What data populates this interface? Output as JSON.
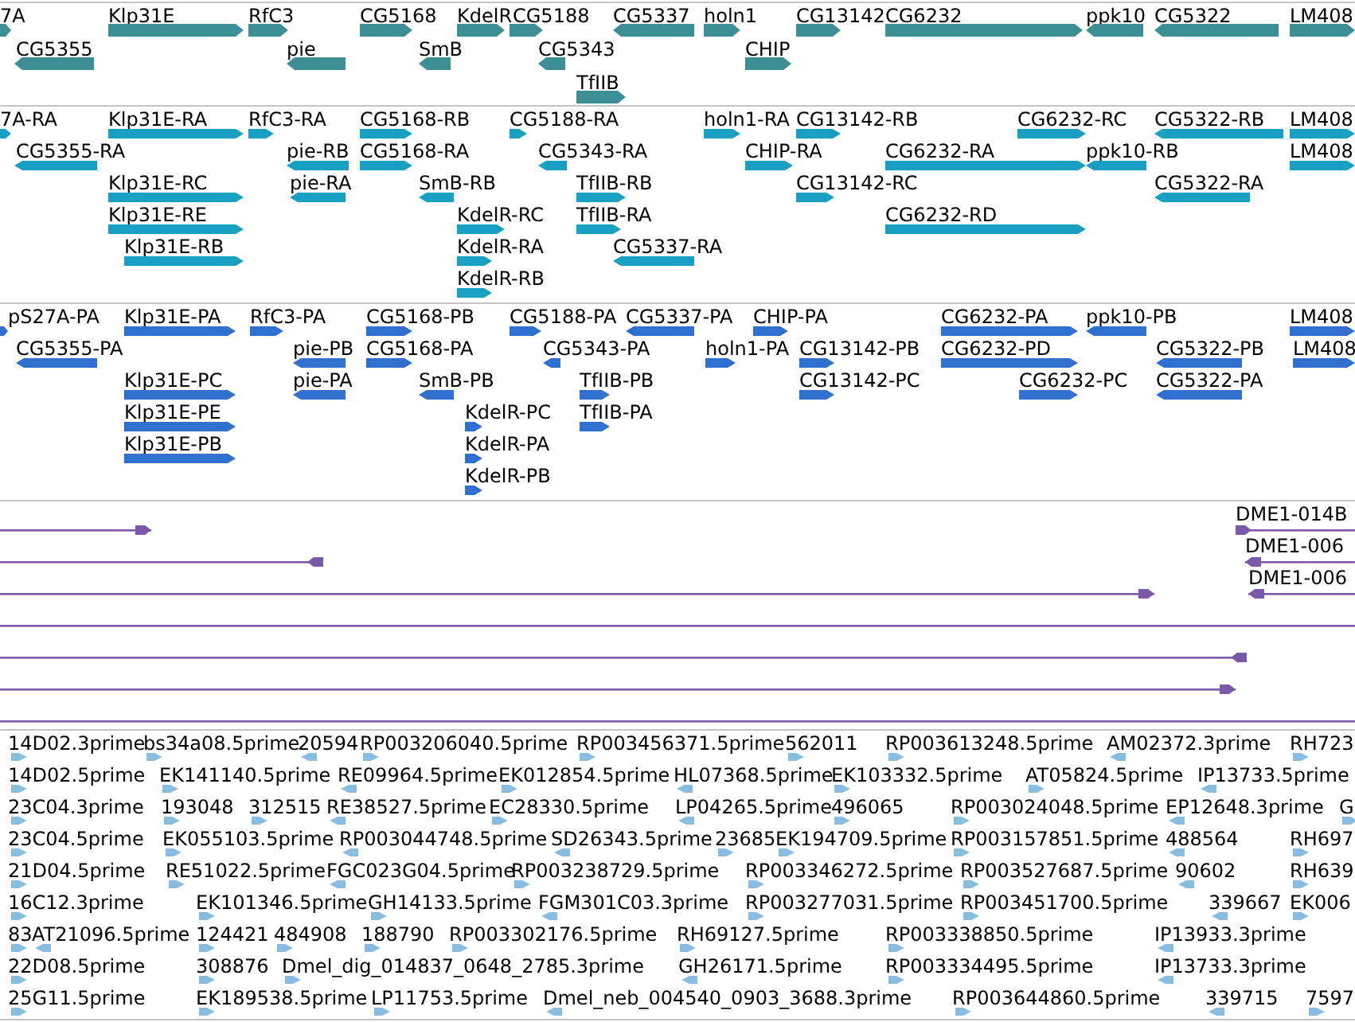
{
  "tracks": [
    {
      "kind": "gene",
      "features": [
        {
          "label": "7A",
          "reverse": false
        },
        {
          "label": "Klp31E",
          "reverse": false
        },
        {
          "label": "RfC3",
          "reverse": false
        },
        {
          "label": "CG5168",
          "reverse": false
        },
        {
          "label": "KdelR",
          "reverse": false
        },
        {
          "label": "CG5188",
          "reverse": false
        },
        {
          "label": "CG5337",
          "reverse": true
        },
        {
          "label": "holn1",
          "reverse": false
        },
        {
          "label": "CG13142",
          "reverse": false
        },
        {
          "label": "CG6232",
          "reverse": false
        },
        {
          "label": "ppk10",
          "reverse": true
        },
        {
          "label": "CG5322",
          "reverse": true
        },
        {
          "label": "LM408",
          "reverse": false
        },
        {
          "label": "CG5355",
          "reverse": true
        },
        {
          "label": "pie",
          "reverse": true
        },
        {
          "label": "SmB",
          "reverse": true
        },
        {
          "label": "CG5343",
          "reverse": true
        },
        {
          "label": "CHIP",
          "reverse": false
        },
        {
          "label": "TfIIB",
          "reverse": false
        }
      ]
    },
    {
      "kind": "transcript",
      "features": [
        {
          "label": "7A-RA",
          "reverse": false
        },
        {
          "label": "Klp31E-RA",
          "reverse": false
        },
        {
          "label": "RfC3-RA",
          "reverse": false
        },
        {
          "label": "CG5168-RB",
          "reverse": false
        },
        {
          "label": "CG5188-RA",
          "reverse": false
        },
        {
          "label": "holn1-RA",
          "reverse": false
        },
        {
          "label": "CG13142-RB",
          "reverse": false
        },
        {
          "label": "CG6232-RC",
          "reverse": false
        },
        {
          "label": "CG5322-RB",
          "reverse": true
        },
        {
          "label": "LM408",
          "reverse": false
        },
        {
          "label": "CG5355-RA",
          "reverse": true
        },
        {
          "label": "pie-RB",
          "reverse": true
        },
        {
          "label": "CG5168-RA",
          "reverse": false
        },
        {
          "label": "CG5343-RA",
          "reverse": true
        },
        {
          "label": "CHIP-RA",
          "reverse": false
        },
        {
          "label": "CG6232-RA",
          "reverse": false
        },
        {
          "label": "ppk10-RB",
          "reverse": true
        },
        {
          "label": "LM408",
          "reverse": false
        },
        {
          "label": "Klp31E-RC",
          "reverse": false
        },
        {
          "label": "pie-RA",
          "reverse": true
        },
        {
          "label": "SmB-RB",
          "reverse": true
        },
        {
          "label": "TfIIB-RB",
          "reverse": false
        },
        {
          "label": "CG13142-RC",
          "reverse": false
        },
        {
          "label": "CG5322-RA",
          "reverse": true
        },
        {
          "label": "Klp31E-RE",
          "reverse": false
        },
        {
          "label": "KdelR-RC",
          "reverse": false
        },
        {
          "label": "TfIIB-RA",
          "reverse": false
        },
        {
          "label": "CG6232-RD",
          "reverse": false
        },
        {
          "label": "Klp31E-RB",
          "reverse": false
        },
        {
          "label": "KdelR-RA",
          "reverse": false
        },
        {
          "label": "CG5337-RA",
          "reverse": true
        },
        {
          "label": "KdelR-RB",
          "reverse": false
        }
      ]
    },
    {
      "kind": "protein",
      "features": [
        {
          "label": "pS27A-PA",
          "reverse": false
        },
        {
          "label": "Klp31E-PA",
          "reverse": false
        },
        {
          "label": "RfC3-PA",
          "reverse": false
        },
        {
          "label": "CG5168-PB",
          "reverse": false
        },
        {
          "label": "CG5188-PA",
          "reverse": false
        },
        {
          "label": "CG5337-PA",
          "reverse": true
        },
        {
          "label": "CHIP-PA",
          "reverse": false
        },
        {
          "label": "CG6232-PA",
          "reverse": false
        },
        {
          "label": "ppk10-PB",
          "reverse": true
        },
        {
          "label": "LM408",
          "reverse": false
        },
        {
          "label": "CG5355-PA",
          "reverse": true
        },
        {
          "label": "pie-PB",
          "reverse": true
        },
        {
          "label": "CG5168-PA",
          "reverse": false
        },
        {
          "label": "CG5343-PA",
          "reverse": true
        },
        {
          "label": "holn1-PA",
          "reverse": false
        },
        {
          "label": "CG13142-PB",
          "reverse": false
        },
        {
          "label": "CG6232-PD",
          "reverse": false
        },
        {
          "label": "CG5322-PB",
          "reverse": true
        },
        {
          "label": "LM408",
          "reverse": false
        },
        {
          "label": "Klp31E-PC",
          "reverse": false
        },
        {
          "label": "pie-PA",
          "reverse": true
        },
        {
          "label": "SmB-PB",
          "reverse": true
        },
        {
          "label": "TfIIB-PB",
          "reverse": false
        },
        {
          "label": "CG13142-PC",
          "reverse": false
        },
        {
          "label": "CG6232-PC",
          "reverse": false
        },
        {
          "label": "CG5322-PA",
          "reverse": true
        },
        {
          "label": "Klp31E-PE",
          "reverse": false
        },
        {
          "label": "KdelR-PC",
          "reverse": false
        },
        {
          "label": "TfIIB-PA",
          "reverse": false
        },
        {
          "label": "Klp31E-PB",
          "reverse": false
        },
        {
          "label": "KdelR-PA",
          "reverse": false
        },
        {
          "label": "KdelR-PB",
          "reverse": false
        }
      ]
    },
    {
      "kind": "alignment",
      "items": [
        {
          "kind": "arrow",
          "reverse": false
        },
        {
          "kind": "arrow",
          "label": "DME1-014B",
          "reverse": false
        },
        {
          "kind": "arrow",
          "reverse": true
        },
        {
          "kind": "arrow",
          "label": "DME1-006",
          "reverse": true
        },
        {
          "kind": "arrow",
          "reverse": false
        },
        {
          "kind": "arrow",
          "label": "DME1-006",
          "reverse": true
        },
        {
          "kind": "plain"
        },
        {
          "kind": "arrow",
          "reverse": true
        },
        {
          "kind": "arrow",
          "reverse": false
        },
        {
          "kind": "plain"
        }
      ]
    },
    {
      "kind": "est",
      "features": [
        {
          "label": "14D02.3prime",
          "reverse": false
        },
        {
          "label": "bs34a08.5prime",
          "reverse": false
        },
        {
          "label": "20594",
          "reverse": true
        },
        {
          "label": "RP003206040.5prime",
          "reverse": false
        },
        {
          "label": "RP003456371.5prime",
          "reverse": false
        },
        {
          "label": "562011",
          "reverse": false
        },
        {
          "label": "RP003613248.5prime",
          "reverse": false
        },
        {
          "label": "AM02372.3prime",
          "reverse": true
        },
        {
          "label": "RH723",
          "reverse": false
        },
        {
          "label": "14D02.5prime",
          "reverse": false
        },
        {
          "label": "EK141140.5prime",
          "reverse": false
        },
        {
          "label": "RE09964.5prime",
          "reverse": true
        },
        {
          "label": "EK012854.5prime",
          "reverse": false
        },
        {
          "label": "HL07368.5prime",
          "reverse": true
        },
        {
          "label": "EK103332.5prime",
          "reverse": false
        },
        {
          "label": "AT05824.5prime",
          "reverse": false
        },
        {
          "label": "IP13733.5prime",
          "reverse": true
        },
        {
          "label": "23C04.3prime",
          "reverse": false
        },
        {
          "label": "193048",
          "reverse": false
        },
        {
          "label": "312515",
          "reverse": false
        },
        {
          "label": "RE38527.5prime",
          "reverse": true
        },
        {
          "label": "EC28330.5prime",
          "reverse": false
        },
        {
          "label": "LP04265.5prime",
          "reverse": true
        },
        {
          "label": "496065",
          "reverse": false
        },
        {
          "label": "RP003024048.5prime",
          "reverse": false
        },
        {
          "label": "EP12648.3prime",
          "reverse": true
        },
        {
          "label": "G",
          "reverse": false
        },
        {
          "label": "23C04.5prime",
          "reverse": false
        },
        {
          "label": "EK055103.5prime",
          "reverse": false
        },
        {
          "label": "RP003044748.5prime",
          "reverse": true
        },
        {
          "label": "SD26343.5prime",
          "reverse": true
        },
        {
          "label": "23685",
          "reverse": false
        },
        {
          "label": "EK194709.5prime",
          "reverse": false
        },
        {
          "label": "RP003157851.5prime",
          "reverse": false
        },
        {
          "label": "488564",
          "reverse": true
        },
        {
          "label": "RH697",
          "reverse": false
        },
        {
          "label": "21D04.5prime",
          "reverse": false
        },
        {
          "label": "RE51022.5prime",
          "reverse": false
        },
        {
          "label": "FGC023G04.5prime",
          "reverse": true
        },
        {
          "label": "RP003238729.5prime",
          "reverse": false
        },
        {
          "label": "RP003346272.5prime",
          "reverse": false
        },
        {
          "label": "RP003527687.5prime",
          "reverse": false
        },
        {
          "label": "90602",
          "reverse": true
        },
        {
          "label": "RH639",
          "reverse": false
        },
        {
          "label": "16C12.3prime",
          "reverse": false
        },
        {
          "label": "EK101346.5prime",
          "reverse": false
        },
        {
          "label": "GH14133.5prime",
          "reverse": false
        },
        {
          "label": "FGM301C03.3prime",
          "reverse": true
        },
        {
          "label": "RP003277031.5prime",
          "reverse": false
        },
        {
          "label": "RP003451700.5prime",
          "reverse": false
        },
        {
          "label": "339667",
          "reverse": true
        },
        {
          "label": "EK006",
          "reverse": false
        },
        {
          "label": "83",
          "reverse": false
        },
        {
          "label": "AT21096.5prime",
          "reverse": true
        },
        {
          "label": "124421",
          "reverse": false
        },
        {
          "label": "484908",
          "reverse": false
        },
        {
          "label": "188790",
          "reverse": false
        },
        {
          "label": "RP003302176.5prime",
          "reverse": false
        },
        {
          "label": "RH69127.5prime",
          "reverse": false
        },
        {
          "label": "RP003338850.5prime",
          "reverse": false
        },
        {
          "label": "IP13933.3prime",
          "reverse": true
        },
        {
          "label": "22D08.5prime",
          "reverse": false
        },
        {
          "label": "308876",
          "reverse": false
        },
        {
          "label": "Dmel_dig_014837_0648_2785.3prime",
          "reverse": false
        },
        {
          "label": "GH26171.5prime",
          "reverse": true
        },
        {
          "label": "RP003334495.5prime",
          "reverse": false
        },
        {
          "label": "IP13733.3prime",
          "reverse": true
        },
        {
          "label": "25G11.5prime",
          "reverse": false
        },
        {
          "label": "EK189538.5prime",
          "reverse": false
        },
        {
          "label": "LP11753.5prime",
          "reverse": false
        },
        {
          "label": "Dmel_neb_004540_0903_3688.3prime",
          "reverse": true
        },
        {
          "label": "RP003644860.5prime",
          "reverse": false
        },
        {
          "label": "339715",
          "reverse": true
        },
        {
          "label": "7597",
          "reverse": false
        }
      ]
    }
  ]
}
